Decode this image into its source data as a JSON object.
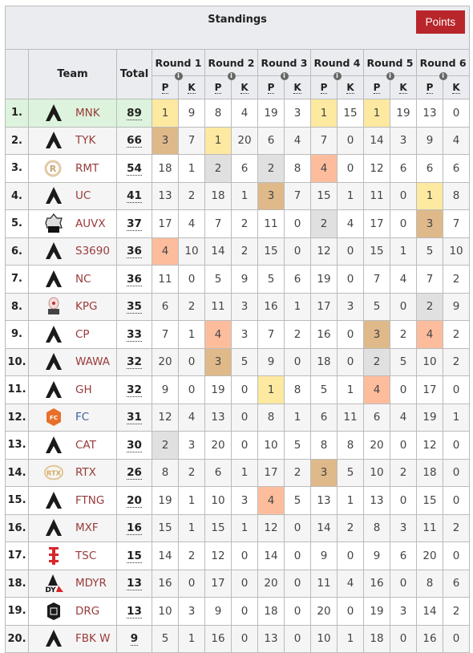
{
  "header": {
    "title": "Standings",
    "points_button": "Points",
    "col_team": "Team",
    "col_total": "Total",
    "rounds": [
      "Round 1",
      "Round 2",
      "Round 3",
      "Round 4",
      "Round 5",
      "Round 6"
    ],
    "sub_p": "P",
    "sub_k": "K",
    "info_glyph": "i"
  },
  "placement_colors": {
    "1": "#fde9a0",
    "2": "#e0e0e0",
    "3": "#dfb98a",
    "4": "#fdbd9d"
  },
  "rows": [
    {
      "rank": "1.",
      "team": "MNK",
      "logo": "apex-logo",
      "total": "89",
      "scores": [
        [
          1,
          9
        ],
        [
          8,
          4
        ],
        [
          19,
          3
        ],
        [
          1,
          15
        ],
        [
          1,
          19
        ],
        [
          13,
          0
        ]
      ]
    },
    {
      "rank": "2.",
      "team": "TYK",
      "logo": "apex-logo",
      "total": "66",
      "scores": [
        [
          3,
          7
        ],
        [
          1,
          20
        ],
        [
          6,
          4
        ],
        [
          7,
          0
        ],
        [
          14,
          3
        ],
        [
          9,
          4
        ]
      ]
    },
    {
      "rank": "3.",
      "team": "RMT",
      "logo": "rmt-logo",
      "total": "54",
      "scores": [
        [
          18,
          1
        ],
        [
          2,
          6
        ],
        [
          2,
          8
        ],
        [
          4,
          0
        ],
        [
          12,
          6
        ],
        [
          6,
          6
        ]
      ]
    },
    {
      "rank": "4.",
      "team": "UC",
      "logo": "apex-logo",
      "total": "41",
      "scores": [
        [
          13,
          2
        ],
        [
          18,
          1
        ],
        [
          3,
          7
        ],
        [
          15,
          1
        ],
        [
          11,
          0
        ],
        [
          1,
          8
        ]
      ]
    },
    {
      "rank": "5.",
      "team": "AUVX",
      "logo": "auvx-logo",
      "total": "37",
      "scores": [
        [
          17,
          4
        ],
        [
          7,
          2
        ],
        [
          11,
          0
        ],
        [
          2,
          4
        ],
        [
          17,
          0
        ],
        [
          3,
          7
        ]
      ]
    },
    {
      "rank": "6.",
      "team": "S3690",
      "logo": "apex-logo",
      "total": "36",
      "scores": [
        [
          4,
          10
        ],
        [
          14,
          2
        ],
        [
          15,
          0
        ],
        [
          12,
          0
        ],
        [
          15,
          1
        ],
        [
          5,
          10
        ]
      ]
    },
    {
      "rank": "7.",
      "team": "NC",
      "logo": "apex-logo",
      "total": "36",
      "scores": [
        [
          11,
          0
        ],
        [
          5,
          9
        ],
        [
          5,
          6
        ],
        [
          19,
          0
        ],
        [
          7,
          4
        ],
        [
          7,
          2
        ]
      ]
    },
    {
      "rank": "8.",
      "team": "KPG",
      "logo": "kpg-logo",
      "total": "35",
      "scores": [
        [
          6,
          2
        ],
        [
          11,
          3
        ],
        [
          16,
          1
        ],
        [
          17,
          3
        ],
        [
          5,
          0
        ],
        [
          2,
          9
        ]
      ]
    },
    {
      "rank": "9.",
      "team": "CP",
      "logo": "apex-logo",
      "total": "33",
      "scores": [
        [
          7,
          1
        ],
        [
          4,
          3
        ],
        [
          7,
          2
        ],
        [
          16,
          0
        ],
        [
          3,
          2
        ],
        [
          4,
          2
        ]
      ]
    },
    {
      "rank": "10.",
      "team": "WAWA",
      "logo": "apex-logo",
      "total": "32",
      "scores": [
        [
          20,
          0
        ],
        [
          3,
          5
        ],
        [
          9,
          0
        ],
        [
          18,
          0
        ],
        [
          2,
          5
        ],
        [
          10,
          2
        ]
      ]
    },
    {
      "rank": "11.",
      "team": "GH",
      "logo": "apex-logo",
      "total": "32",
      "scores": [
        [
          9,
          0
        ],
        [
          19,
          0
        ],
        [
          1,
          8
        ],
        [
          5,
          1
        ],
        [
          4,
          0
        ],
        [
          17,
          0
        ]
      ]
    },
    {
      "rank": "12.",
      "team": "FC",
      "logo": "fc-logo",
      "total": "31",
      "scores": [
        [
          12,
          4
        ],
        [
          13,
          0
        ],
        [
          8,
          1
        ],
        [
          6,
          11
        ],
        [
          6,
          4
        ],
        [
          19,
          1
        ]
      ]
    },
    {
      "rank": "13.",
      "team": "CAT",
      "logo": "apex-logo",
      "total": "30",
      "scores": [
        [
          2,
          3
        ],
        [
          20,
          0
        ],
        [
          10,
          5
        ],
        [
          8,
          8
        ],
        [
          20,
          0
        ],
        [
          12,
          0
        ]
      ]
    },
    {
      "rank": "14.",
      "team": "RTX",
      "logo": "rtx-logo",
      "total": "26",
      "scores": [
        [
          8,
          2
        ],
        [
          6,
          1
        ],
        [
          17,
          2
        ],
        [
          3,
          5
        ],
        [
          10,
          2
        ],
        [
          18,
          0
        ]
      ]
    },
    {
      "rank": "15.",
      "team": "FTNG",
      "logo": "apex-logo",
      "total": "20",
      "scores": [
        [
          19,
          1
        ],
        [
          10,
          3
        ],
        [
          4,
          5
        ],
        [
          13,
          1
        ],
        [
          13,
          0
        ],
        [
          15,
          0
        ]
      ]
    },
    {
      "rank": "16.",
      "team": "MXF",
      "logo": "apex-logo",
      "total": "16",
      "scores": [
        [
          15,
          1
        ],
        [
          15,
          1
        ],
        [
          12,
          0
        ],
        [
          14,
          2
        ],
        [
          8,
          3
        ],
        [
          11,
          2
        ]
      ]
    },
    {
      "rank": "17.",
      "team": "TSC",
      "logo": "tsc-logo",
      "total": "15",
      "scores": [
        [
          14,
          2
        ],
        [
          12,
          0
        ],
        [
          14,
          0
        ],
        [
          9,
          0
        ],
        [
          9,
          6
        ],
        [
          20,
          0
        ]
      ]
    },
    {
      "rank": "18.",
      "team": "MDYR",
      "logo": "mdyr-logo",
      "total": "13",
      "scores": [
        [
          16,
          0
        ],
        [
          17,
          0
        ],
        [
          20,
          0
        ],
        [
          11,
          4
        ],
        [
          16,
          0
        ],
        [
          8,
          6
        ]
      ]
    },
    {
      "rank": "19.",
      "team": "DRG",
      "logo": "drg-logo",
      "total": "13",
      "scores": [
        [
          10,
          3
        ],
        [
          9,
          0
        ],
        [
          18,
          0
        ],
        [
          20,
          0
        ],
        [
          19,
          3
        ],
        [
          14,
          2
        ]
      ]
    },
    {
      "rank": "20.",
      "team": "FBK W",
      "logo": "apex-logo",
      "total": "9",
      "scores": [
        [
          5,
          1
        ],
        [
          16,
          0
        ],
        [
          13,
          0
        ],
        [
          10,
          1
        ],
        [
          18,
          0
        ],
        [
          16,
          0
        ]
      ]
    }
  ]
}
